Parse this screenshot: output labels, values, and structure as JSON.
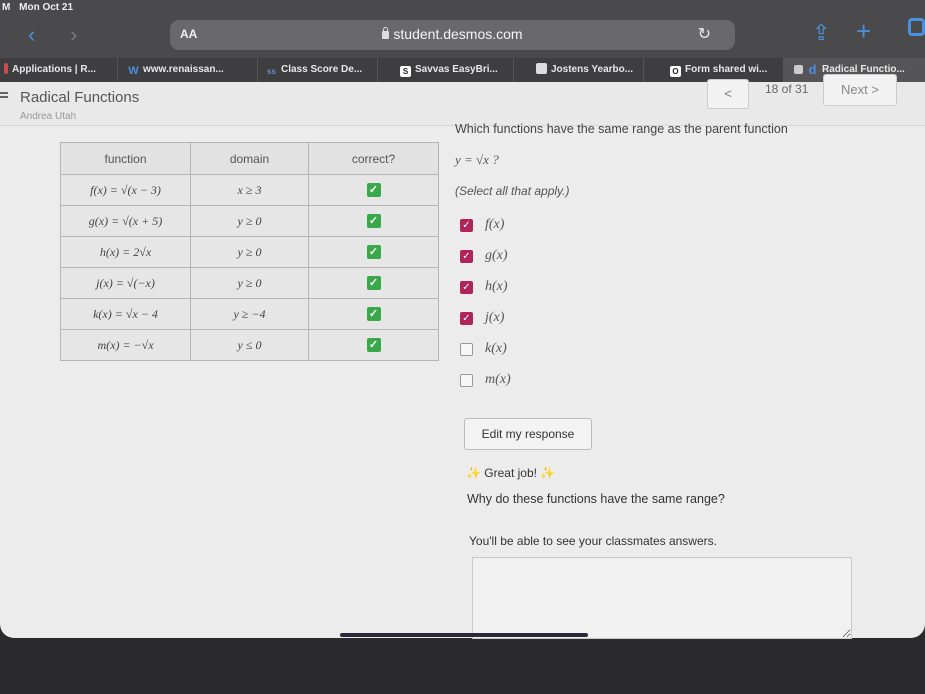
{
  "status_bar": {
    "time": "M",
    "date": "Mon Oct 21"
  },
  "browser": {
    "text_size_label": "AA",
    "url": "student.desmos.com",
    "icons": {
      "back": "chevron-left-icon",
      "forward": "chevron-right-icon",
      "reload": "reload-icon",
      "share": "share-icon",
      "new_tab": "plus-icon",
      "tabs": "tabs-icon",
      "lock": "lock-icon"
    }
  },
  "tabs": [
    {
      "label": "Applications | R...",
      "icon": "app-icon"
    },
    {
      "label": "www.renaissan...",
      "icon": "W"
    },
    {
      "label": "Class Score De...",
      "icon": "ss"
    },
    {
      "label": "Savvas EasyBri...",
      "icon": "S"
    },
    {
      "label": "Jostens Yearbo...",
      "icon": "J"
    },
    {
      "label": "Form shared wi...",
      "icon": "O"
    },
    {
      "label": "Radical Functio...",
      "icon": "d",
      "active": true
    }
  ],
  "activity": {
    "title": "Radical Functions",
    "student": "Andrea Utah",
    "prev_label": "<",
    "page_counter": "18 of 31",
    "next_label": "Next >"
  },
  "table": {
    "headers": [
      "function",
      "domain",
      "correct?"
    ],
    "rows": [
      {
        "function": "f(x) = √(x − 3)",
        "domain": "x ≥ 3",
        "correct": true
      },
      {
        "function": "g(x) = √(x + 5)",
        "domain": "y ≥ 0",
        "correct": true
      },
      {
        "function": "h(x) = 2√x",
        "domain": "y ≥ 0",
        "correct": true
      },
      {
        "function": "j(x) = √(−x)",
        "domain": "y ≥ 0",
        "correct": true
      },
      {
        "function": "k(x) = √x − 4",
        "domain": "y ≥ −4",
        "correct": true
      },
      {
        "function": "m(x) = −√x",
        "domain": "y ≤ 0",
        "correct": true
      }
    ]
  },
  "question": {
    "prompt": "Which functions have the same range as the parent function",
    "math": "y = √x ?",
    "instruction": "(Select all that apply.)",
    "options": [
      {
        "label": "f(x)",
        "checked": true
      },
      {
        "label": "g(x)",
        "checked": true
      },
      {
        "label": "h(x)",
        "checked": true
      },
      {
        "label": "j(x)",
        "checked": true
      },
      {
        "label": "k(x)",
        "checked": false
      },
      {
        "label": "m(x)",
        "checked": false
      }
    ],
    "edit_label": "Edit my response",
    "feedback": "Great job!",
    "followup": "Why do these functions have the same range?",
    "share_note": "You'll be able to see your classmates answers.",
    "answer_value": ""
  },
  "colors": {
    "checkbox_accent": "#b0245a",
    "correct_green": "#3aa84a",
    "browser_accent": "#4a90e2"
  }
}
